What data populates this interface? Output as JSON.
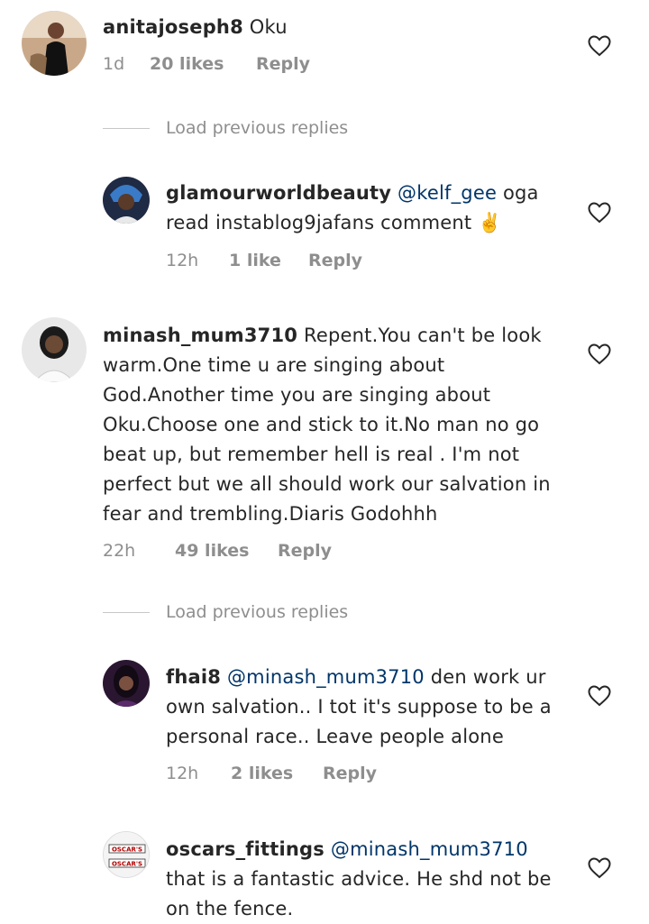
{
  "comments": [
    {
      "username": "anitajoseph8",
      "text": "Oku",
      "time": "1d",
      "likes": "20 likes",
      "reply": "Reply"
    },
    {
      "username": "glamourworldbeauty",
      "mention": "@kelf_gee",
      "text": "oga read instablog9jafans comment ✌️",
      "time": "12h",
      "likes": "1 like",
      "reply": "Reply"
    },
    {
      "username": "minash_mum3710",
      "text": "Repent.You can't be look warm.One time u are singing about God.Another time you are singing about Oku.Choose one and stick to it.No man no go beat up, but remember hell is real . I'm not perfect but we all should work our salvation in fear and trembling.Diaris Godohhh",
      "time": "22h",
      "likes": "49 likes",
      "reply": "Reply"
    },
    {
      "username": "fhai8",
      "mention": "@minash_mum3710",
      "text": "den work ur own salvation.. I tot it's suppose to be a personal race.. Leave people alone",
      "time": "12h",
      "likes": "2 likes",
      "reply": "Reply"
    },
    {
      "username": "oscars_fittings",
      "mention": "@minash_mum3710",
      "text": "that is a fantastic advice. He shd not be on the fence.",
      "avatar_text": "OSCAR'S"
    }
  ],
  "load_previous": "Load previous replies",
  "colors": {
    "text": "#262626",
    "meta": "#8e8e8e",
    "mention": "#003569",
    "divider": "#c7c7c7"
  },
  "icons": {
    "like": "heart-outline-icon"
  }
}
